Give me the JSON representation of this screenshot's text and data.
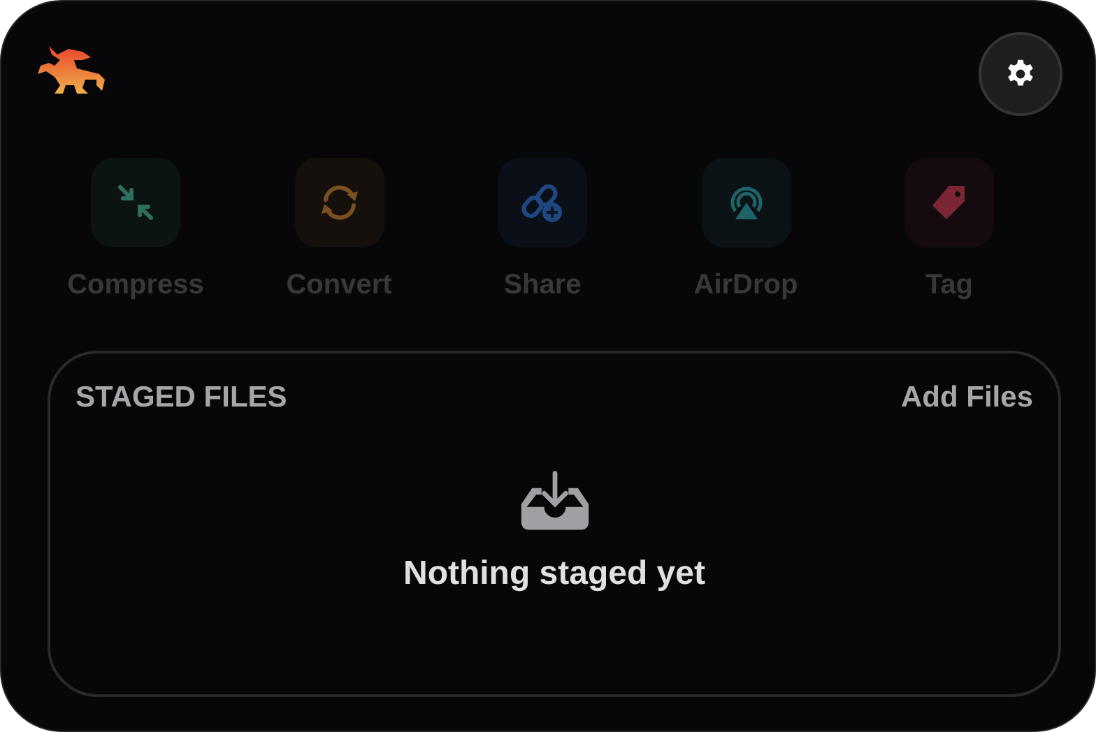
{
  "actions": [
    {
      "label": "Compress",
      "kind": "compress",
      "color": "#2d6e5e",
      "disabled": true
    },
    {
      "label": "Convert",
      "kind": "convert",
      "color": "#7a4f22",
      "disabled": true
    },
    {
      "label": "Share",
      "kind": "share",
      "color": "#1f4782",
      "disabled": true
    },
    {
      "label": "AirDrop",
      "kind": "airdrop",
      "color": "#1f6368",
      "disabled": true
    },
    {
      "label": "Tag",
      "kind": "tag",
      "color": "#7a2634",
      "disabled": true
    }
  ],
  "staged": {
    "title": "STAGED FILES",
    "add_label": "Add Files",
    "empty_text": "Nothing staged yet"
  }
}
